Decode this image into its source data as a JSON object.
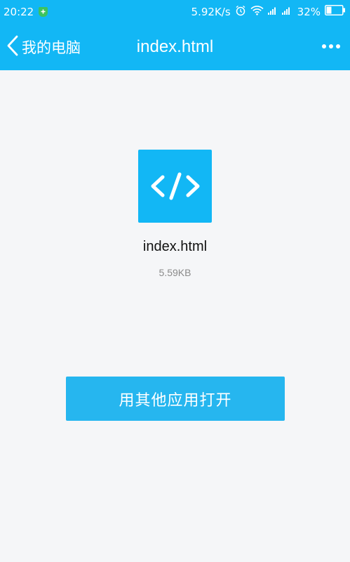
{
  "status_bar": {
    "time": "20:22",
    "net_speed": "5.92K/s",
    "battery_percent": "32%",
    "battery_level": 0.32,
    "icons": [
      "shield-icon",
      "alarm-icon",
      "wifi-icon",
      "signal-icon",
      "battery-icon"
    ]
  },
  "nav": {
    "back_label": "我的电脑",
    "title": "index.html",
    "back_icon": "chevron-left-icon",
    "more_icon": "more-dots-icon"
  },
  "file": {
    "icon_glyph": "</>",
    "name": "index.html",
    "size": "5.59KB"
  },
  "actions": {
    "open_with_label": "用其他应用打开"
  },
  "colors": {
    "accent": "#12b7f5",
    "button": "#26b6ef",
    "background": "#f5f6f8",
    "size_text": "#8a8a8a"
  }
}
